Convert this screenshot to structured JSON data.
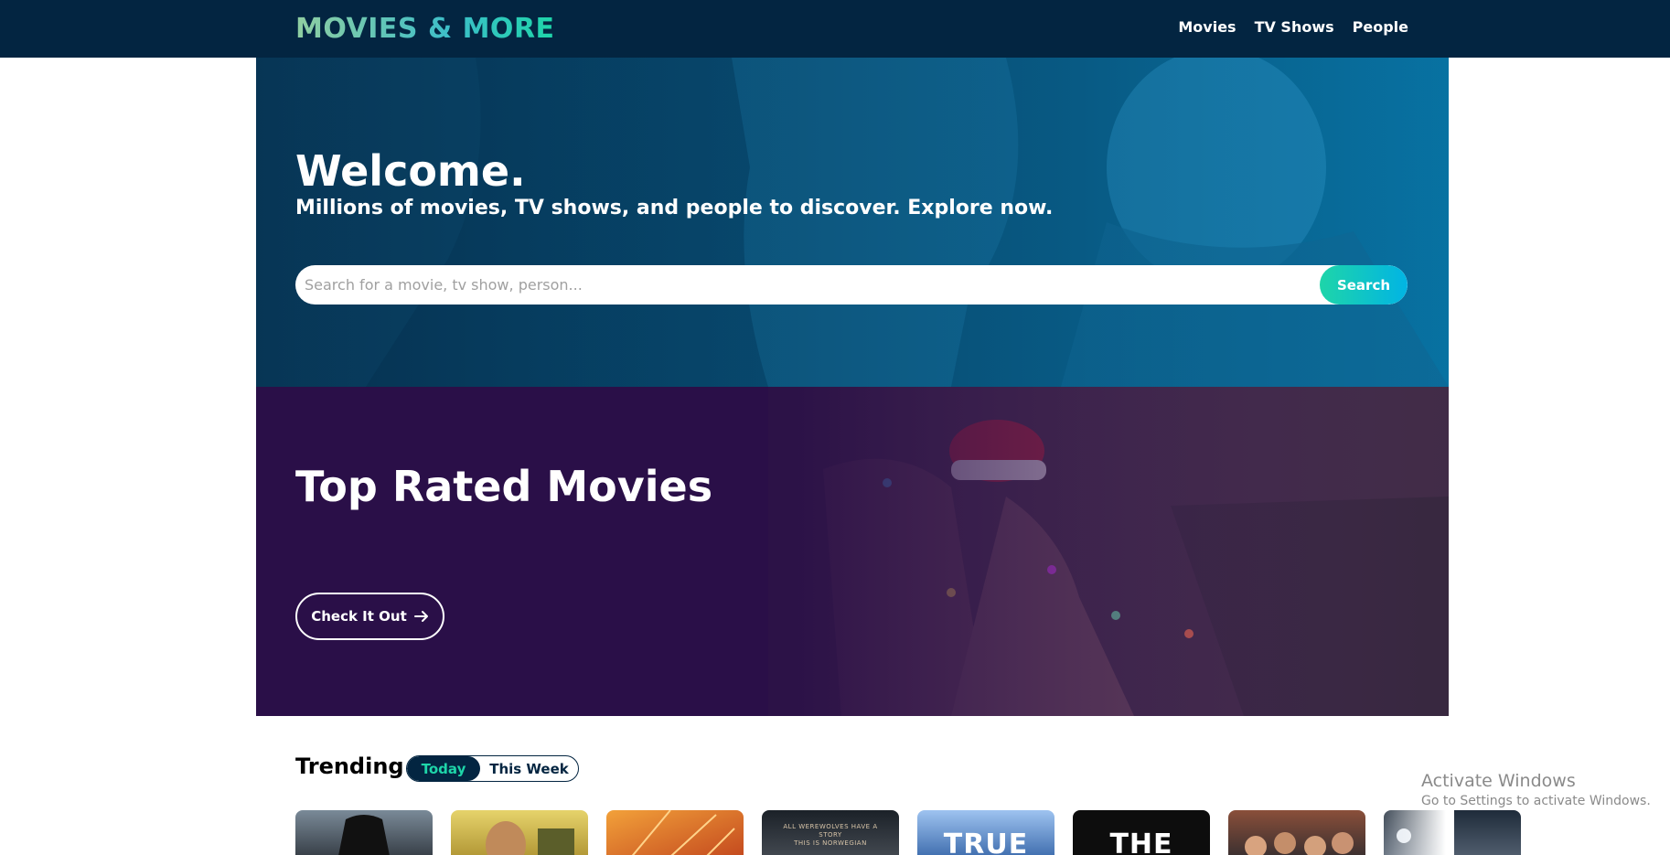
{
  "header": {
    "brand": "MOVIES & MORE",
    "nav": [
      "Movies",
      "TV Shows",
      "People"
    ]
  },
  "hero": {
    "title": "Welcome.",
    "subtitle": "Millions of movies, TV shows, and people to discover. Explore now.",
    "search": {
      "placeholder": "Search for a movie, tv show, person...",
      "button_label": "Search"
    }
  },
  "promo": {
    "title": "Top Rated Movies",
    "button_label": "Check It Out",
    "button_icon": "arrow-right-icon"
  },
  "trending": {
    "title": "Trending",
    "tabs": [
      "Today",
      "This Week"
    ],
    "selected_tab": "Today",
    "poster_texts": {
      "poster_4": "ALL WEREWOLVES HAVE A STORY\nTHIS IS NORWEGIAN",
      "poster_5": "TRUE",
      "poster_6": "THE"
    }
  },
  "watermark": {
    "title": "Activate Windows",
    "subtitle": "Go to Settings to activate Windows."
  },
  "colors": {
    "navbar": "#032541",
    "accent": "#1ed5a9",
    "accent_secondary": "#01b4e4",
    "hero_tint": "#0d5f8a",
    "promo_tint": "#2a0f48"
  }
}
